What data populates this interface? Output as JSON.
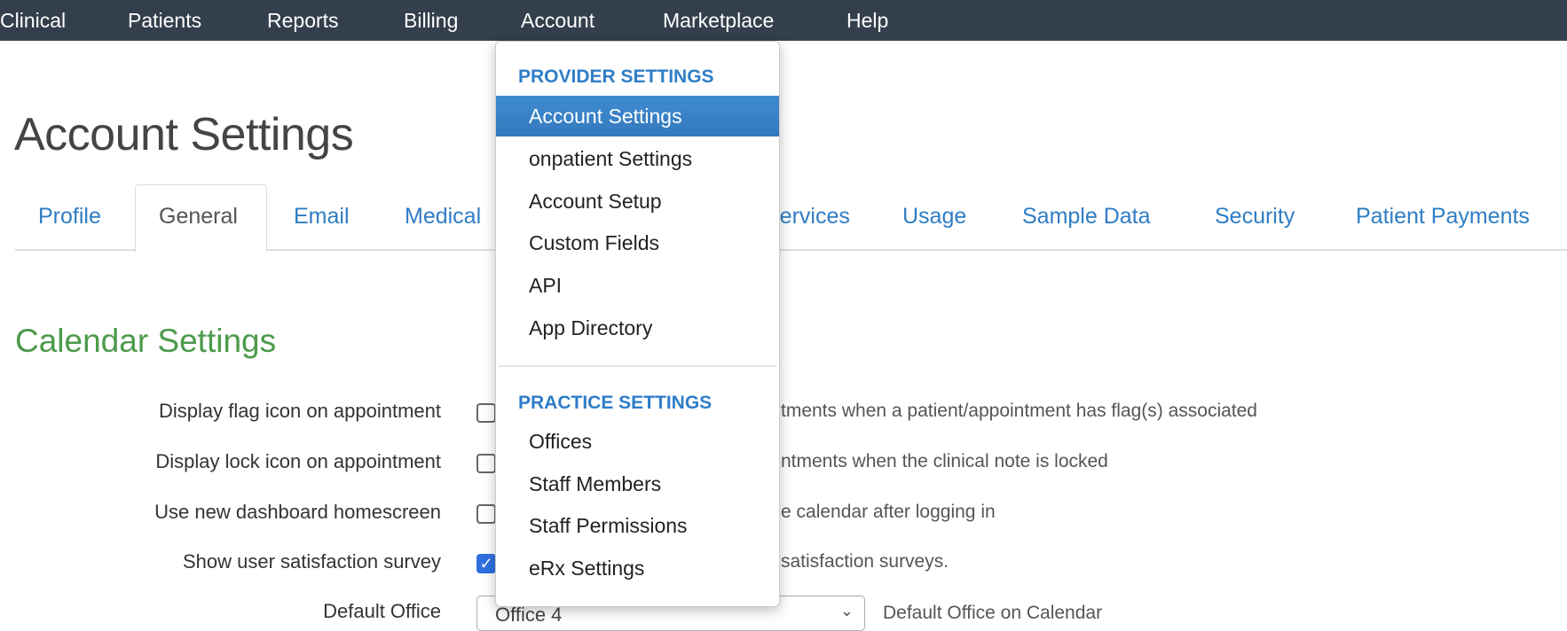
{
  "nav": {
    "items": [
      "Clinical",
      "Patients",
      "Reports",
      "Billing",
      "Account",
      "Marketplace",
      "Help"
    ]
  },
  "page": {
    "title": "Account Settings"
  },
  "tabs": [
    "Profile",
    "General",
    "Email",
    "Medical",
    "Services",
    "Usage",
    "Sample Data",
    "Security",
    "Patient Payments"
  ],
  "active_tab": "General",
  "section": {
    "title": "Calendar Settings"
  },
  "settings": [
    {
      "label": "Display flag icon on appointment",
      "checked": false,
      "desc": "tments when a patient/appointment has flag(s) associated"
    },
    {
      "label": "Display lock icon on appointment",
      "checked": false,
      "desc": "ntments when the clinical note is locked"
    },
    {
      "label": "Use new dashboard homescreen",
      "checked": false,
      "desc": "e calendar after logging in"
    },
    {
      "label": "Show user satisfaction survey",
      "checked": true,
      "desc": "satisfaction surveys."
    }
  ],
  "default_office": {
    "label": "Default Office",
    "value": "Office 4",
    "help": "Default Office on Calendar"
  },
  "account_menu": {
    "provider_header": "PROVIDER SETTINGS",
    "provider_items": [
      "Account Settings",
      "onpatient Settings",
      "Account Setup",
      "Custom Fields",
      "API",
      "App Directory"
    ],
    "practice_header": "PRACTICE SETTINGS",
    "practice_items": [
      "Offices",
      "Staff Members",
      "Staff Permissions",
      "eRx Settings"
    ],
    "highlighted": "Account Settings"
  },
  "colors": {
    "nav_bg": "#343f4d",
    "link": "#2f7dc4",
    "section_green": "#4c9a4c",
    "menu_highlight": "#3a82c6"
  }
}
